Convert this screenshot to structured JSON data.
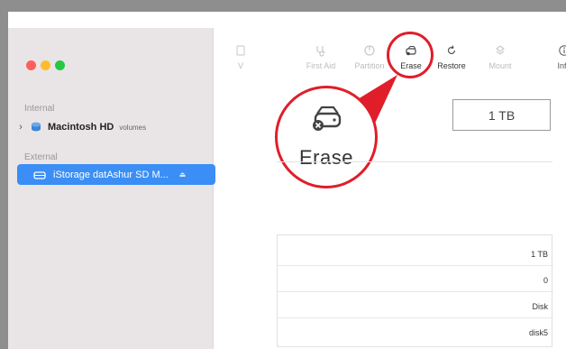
{
  "sidebar": {
    "section_internal": "Internal",
    "section_external": "External",
    "macintosh": {
      "name": "Macintosh HD",
      "sub": "volumes"
    },
    "selected": {
      "name": "iStorage datAshur SD M...",
      "eject": "⏏"
    }
  },
  "toolbar": {
    "volume_label": "V",
    "first_aid_label": "First Aid",
    "partition_label": "Partition",
    "erase_label": "Erase",
    "restore_label": "Restore",
    "mount_label": "Mount",
    "info_label": "Info"
  },
  "callout": {
    "label": "Erase"
  },
  "capacity": "1 TB",
  "info_table": {
    "rows": [
      {
        "value": "1 TB"
      },
      {
        "value": "0"
      },
      {
        "value": "Disk"
      },
      {
        "value": "disk5"
      }
    ]
  },
  "colors": {
    "highlight_ring": "#e01e2a",
    "selection": "#3a8ef5"
  }
}
